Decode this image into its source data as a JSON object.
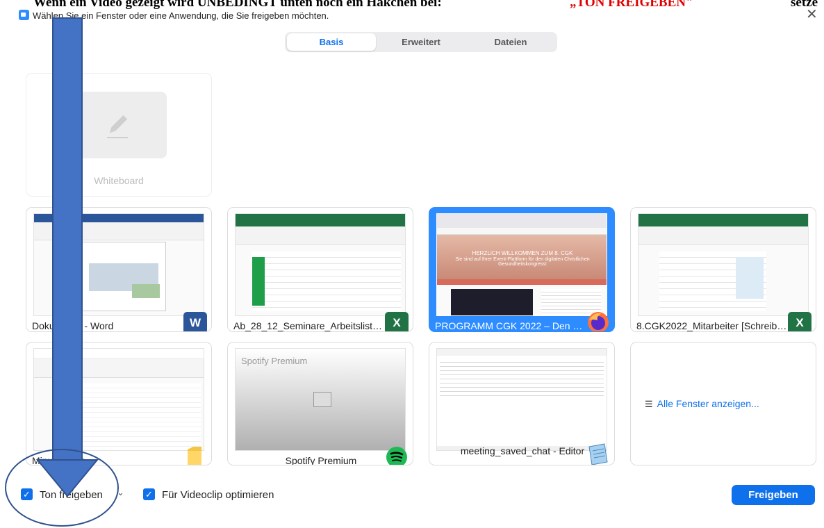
{
  "banner": {
    "part1": "Wenn ein Video gezeigt wird UNBEDINGT unten noch ein Häkchen bei:",
    "part2": "„TON FREIGEBEN\"",
    "part3": "setze"
  },
  "dialog": {
    "title": "Wählen Sie ein Fenster oder eine Anwendung, die Sie freigeben möchten.",
    "close_glyph": "✕"
  },
  "tabs": [
    {
      "label": "Basis",
      "active": true
    },
    {
      "label": "Erweitert",
      "active": false
    },
    {
      "label": "Dateien",
      "active": false
    }
  ],
  "whiteboard": {
    "label": "Whiteboard",
    "icon": "pencil-icon"
  },
  "windows": [
    {
      "label": "Dokument1 - Word",
      "app": "word",
      "badge": "W"
    },
    {
      "label": "Ab_28_12_Seminare_Arbeitsliste_...",
      "app": "excel",
      "badge": "X"
    },
    {
      "label": "PROGRAMM CGK 2022 – Den 8. ...",
      "app": "firefox",
      "selected": true
    },
    {
      "label": "8.CGK2022_Mitarbeiter  [Schreibg...",
      "app": "excel",
      "badge": "X"
    },
    {
      "label": "MinutenPlus",
      "app": "explorer"
    },
    {
      "label": "Spotify Premium",
      "app": "spotify",
      "thumb_text": "Spotify Premium"
    },
    {
      "label": "meeting_saved_chat - Editor",
      "app": "notepad"
    }
  ],
  "web_thumb": {
    "heading": "HERZLICH WILLKOMMEN ZUM 8. CGK",
    "subheading": "Sie sind auf Ihrer Event-Plattform für den digitalen Christlichen Gesundheitskongress!"
  },
  "all_windows": {
    "label": "Alle Fenster anzeigen...",
    "icon": "stack-icon"
  },
  "footer": {
    "share_audio": {
      "label": "Ton freigeben",
      "checked": true
    },
    "optimize_video": {
      "label": "Für Videoclip optimieren",
      "checked": true
    },
    "share_button": "Freigeben"
  },
  "colors": {
    "accent": "#0e71eb",
    "selected_tile": "#2d8cff",
    "word": "#2b579a",
    "excel": "#217346",
    "arrow": "#4472c4"
  }
}
